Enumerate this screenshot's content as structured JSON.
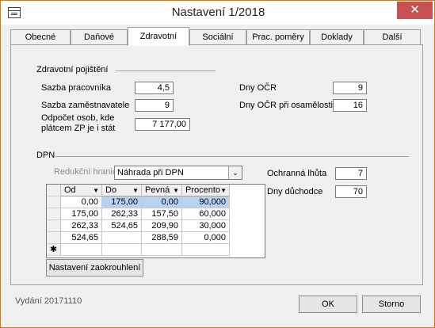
{
  "window": {
    "title": "Nastavení 1/2018",
    "close_glyph": "✕"
  },
  "tabs": [
    {
      "label": "Obecné"
    },
    {
      "label": "Daňové"
    },
    {
      "label": "Zdravotní"
    },
    {
      "label": "Sociální"
    },
    {
      "label": "Prac. poměry"
    },
    {
      "label": "Doklady"
    },
    {
      "label": "Další"
    }
  ],
  "health": {
    "group_label": "Zdravotní pojištění",
    "employee_rate_label": "Sazba pracovníka",
    "employee_rate_value": "4,5",
    "employer_rate_label": "Sazba zaměstnavatele",
    "employer_rate_value": "9",
    "deduction_label_line1": "Odpočet osob, kde",
    "deduction_label_line2": "plátcem ZP je i stát",
    "deduction_value": "7 177,00",
    "ocr_days_label": "Dny OČR",
    "ocr_days_value": "9",
    "ocr_single_label": "Dny OČR při osamělosti",
    "ocr_single_value": "16"
  },
  "dpn": {
    "group_label": "DPN",
    "reduction_label": "Redukční hranice",
    "reduction_value": "Náhrada při DPN",
    "protection_label": "Ochranná lhůta",
    "protection_value": "7",
    "pension_days_label": "Dny důchodce",
    "pension_days_value": "70",
    "grid": {
      "columns": [
        "Od",
        "Do",
        "Pevná",
        "Procento"
      ],
      "rows": [
        [
          "0,00",
          "175,00",
          "0,00",
          "90,000"
        ],
        [
          "175,00",
          "262,33",
          "157,50",
          "60,000"
        ],
        [
          "262,33",
          "524,65",
          "209,90",
          "30,000"
        ],
        [
          "524,65",
          "",
          "288,59",
          "0,000"
        ]
      ],
      "new_row_marker": "✱"
    },
    "rounding_button": "Nastavení zaokrouhlení"
  },
  "footer": {
    "version": "Vydání 20171110",
    "ok": "OK",
    "cancel": "Storno"
  }
}
